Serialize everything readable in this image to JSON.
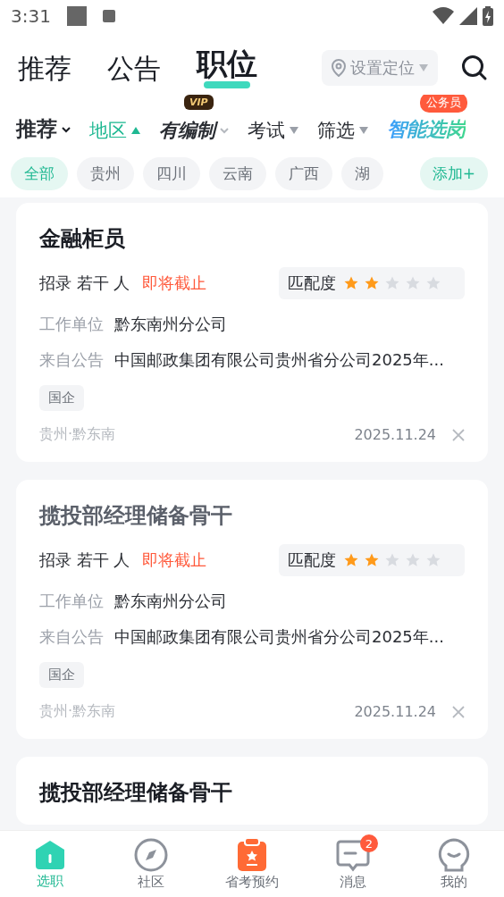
{
  "status_bar": {
    "time": "3:31"
  },
  "top_tabs": [
    {
      "label": "推荐",
      "selected": false
    },
    {
      "label": "公告",
      "selected": false
    },
    {
      "label": "职位",
      "selected": true
    }
  ],
  "location": {
    "placeholder": "设置定位"
  },
  "filters": [
    {
      "kind": "sort",
      "label": "推荐",
      "selected": false
    },
    {
      "kind": "dropdown",
      "label": "地区",
      "selected": true
    },
    {
      "kind": "vip",
      "prefix": "有",
      "label": "编制",
      "badge": "VIP",
      "selected": false
    },
    {
      "kind": "dropdown",
      "label": "考试",
      "selected": false
    },
    {
      "kind": "dropdown",
      "label": "筛选",
      "selected": false
    },
    {
      "kind": "smart",
      "label": "智能选岗",
      "badge": "公务员"
    }
  ],
  "regions": [
    {
      "label": "全部",
      "selected": true
    },
    {
      "label": "贵州",
      "selected": false
    },
    {
      "label": "四川",
      "selected": false
    },
    {
      "label": "云南",
      "selected": false
    },
    {
      "label": "广西",
      "selected": false
    },
    {
      "label": "湖",
      "selected": false
    }
  ],
  "add_button": "添加+",
  "jobs": [
    {
      "title": "金融柜员",
      "viewed": false,
      "hiring": "招录 若干 人",
      "deadline": "即将截止",
      "match_label": "匹配度",
      "stars": 2,
      "unit_label": "工作单位",
      "unit": "黔东南州分公司",
      "source_label": "来自公告",
      "source": "中国邮政集团有限公司贵州省分公司2025年...",
      "tag": "国企",
      "place": "贵州·黔东南",
      "date": "2025.11.24"
    },
    {
      "title": "揽投部经理储备骨干",
      "viewed": true,
      "hiring": "招录 若干 人",
      "deadline": "即将截止",
      "match_label": "匹配度",
      "stars": 2,
      "unit_label": "工作单位",
      "unit": "黔东南州分公司",
      "source_label": "来自公告",
      "source": "中国邮政集团有限公司贵州省分公司2025年...",
      "tag": "国企",
      "place": "贵州·黔东南",
      "date": "2025.11.24"
    },
    {
      "title": "揽投部经理储备骨干",
      "viewed": false
    }
  ],
  "bottom_nav": [
    {
      "kind": "home",
      "label": "选职",
      "selected": true
    },
    {
      "kind": "compass",
      "label": "社区",
      "selected": false
    },
    {
      "kind": "clipboard",
      "label": "省考预约",
      "selected": false
    },
    {
      "kind": "message",
      "label": "消息",
      "selected": false,
      "badge": "2"
    },
    {
      "kind": "face",
      "label": "我的",
      "selected": false
    }
  ]
}
